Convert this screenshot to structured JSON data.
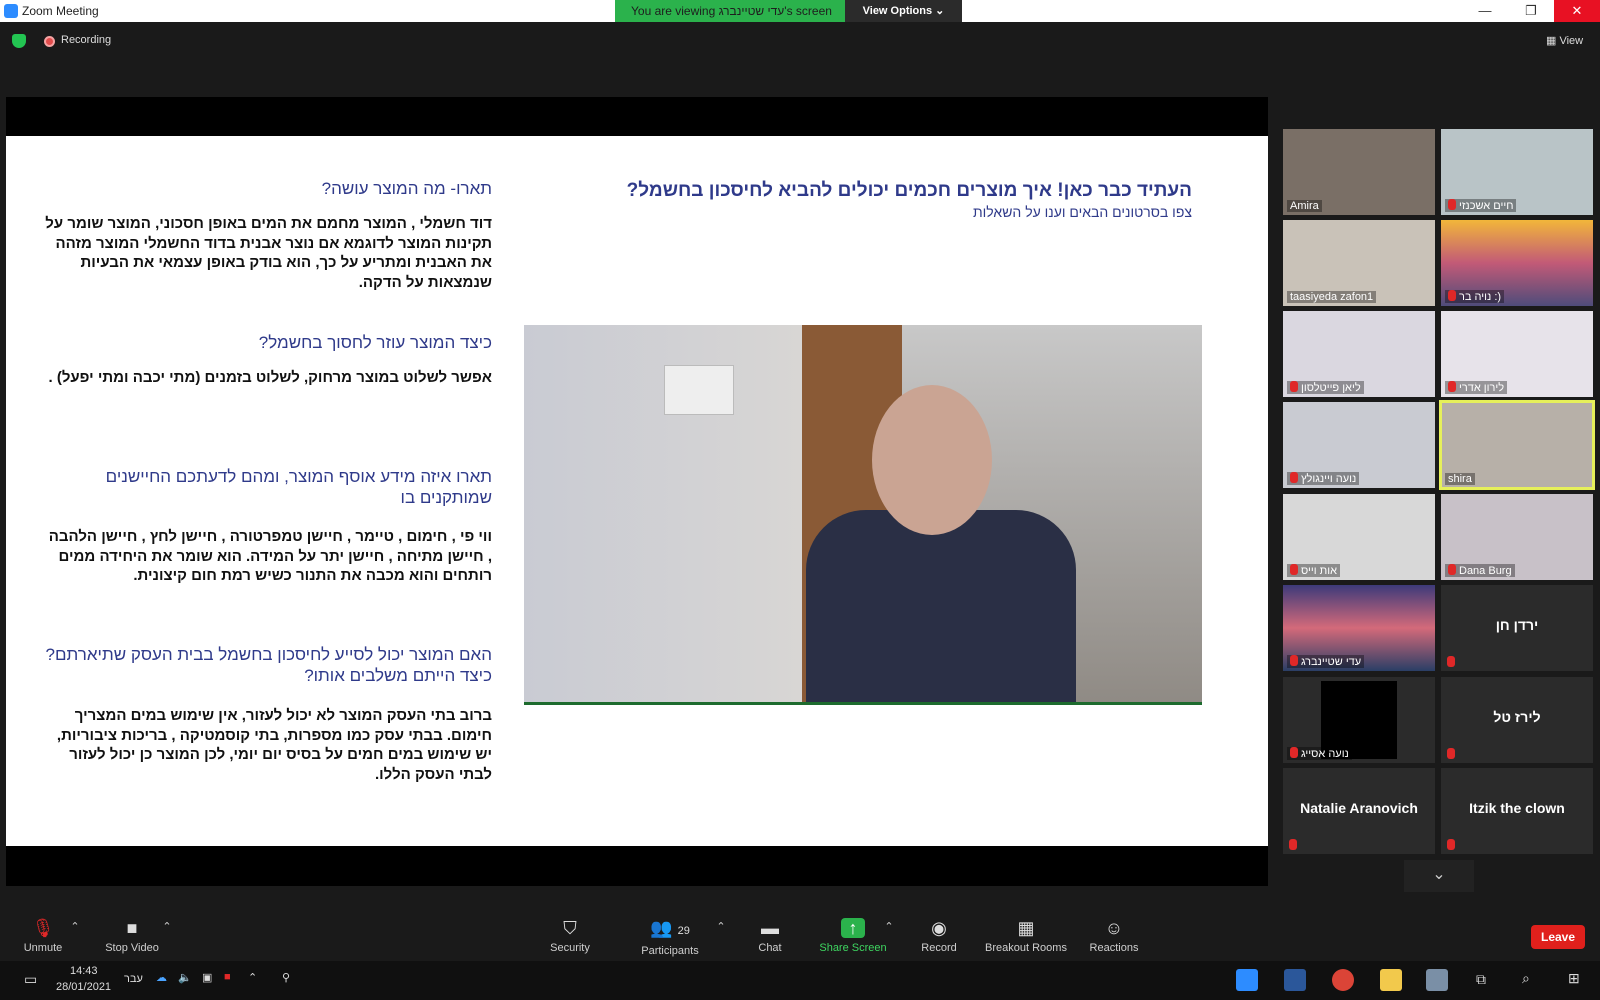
{
  "titlebar": {
    "app_title": "Zoom Meeting",
    "viewing_banner": "You are viewing עדי שטיינברג's screen",
    "view_options": "View Options ⌄",
    "min": "—",
    "max": "❐",
    "close": "✕"
  },
  "status": {
    "recording": "Recording",
    "view": "View"
  },
  "slide": {
    "title": "העתיד כבר כאן! איך מוצרים חכמים יכולים להביא לחיסכון בחשמל?",
    "subtitle": "צפו בסרטונים הבאים וענו על השאלות",
    "sections": [
      {
        "q": "תארו- מה המוצר עושה?",
        "a": "דוד חשמלי , המוצר מחמם את המים באופן חסכוני, המוצר שומר על תקינות המוצר לדוגמא אם נוצר אבנית בדוד החשמלי המוצר מזהה את האבנית ומתריע על כך, הוא בודק באופן עצמאי את הבעיות שנמצאות על הדקה."
      },
      {
        "q": "כיצד המוצר עוזר לחסוך בחשמל?",
        "a": "אפשר לשלוט במוצר מרחוק, לשלוט בזמנים (מתי יכבה ומתי יפעל) ."
      },
      {
        "q": "תארו איזה מידע אוסף המוצר, ומהם לדעתכם החיישנים שמותקנים בו",
        "a": "ווי פי , חימום , טיימר , חיישן טמפרטורה , חיישן לחץ , חיישן הלהבה , חיישן מתיחה , חיישן יתר על המידה. הוא שומר את היחידה ממים רותחים והוא מכבה את התנור כשיש רמת חום קיצונית."
      },
      {
        "q": "האם המוצר יכול לסייע לחיסכון בחשמל בבית העסק שתיארתם? כיצד הייתם משלבים אותו?",
        "a": "ברוב בתי העסק המוצר לא יכול לעזור, אין שימוש במים המצריך חימום. בבתי עסק כמו מספרות, בתי קוסמטיקה , בריכות ציבוריות, יש שימוש במים חמים על בסיס יום יומי, לכן המוצר כן יכול לעזור לבתי העסק הללו."
      }
    ]
  },
  "participants": [
    {
      "name": "Amira",
      "muted": false
    },
    {
      "name": "חיים אשכנזי",
      "muted": true
    },
    {
      "name": "taasiyeda zafon1",
      "muted": false
    },
    {
      "name": "נויה בר :)",
      "muted": true
    },
    {
      "name": "ליאן פייטלסון",
      "muted": true
    },
    {
      "name": "לירון אדרי",
      "muted": true
    },
    {
      "name": "נועה ויינגולץ",
      "muted": true
    },
    {
      "name": "shira",
      "muted": false
    },
    {
      "name": "אות וייס",
      "muted": true
    },
    {
      "name": "Dana Burg",
      "muted": true
    },
    {
      "name": "עדי שטיינברג",
      "muted": true
    },
    {
      "name": "ירדן חן",
      "muted": true
    },
    {
      "name": "נועה אסייג",
      "muted": true
    },
    {
      "name": "לירז טל",
      "muted": true
    },
    {
      "name": "Natalie Aranovich",
      "muted": true
    },
    {
      "name": "Itzik the clown",
      "muted": true
    }
  ],
  "toolbar": {
    "unmute": "Unmute",
    "stop_video": "Stop Video",
    "security": "Security",
    "participants": "Participants",
    "participants_count": "29",
    "chat": "Chat",
    "share_screen": "Share Screen",
    "record": "Record",
    "breakout": "Breakout Rooms",
    "reactions": "Reactions",
    "leave": "Leave"
  },
  "taskbar": {
    "time": "14:43",
    "date": "28/01/2021",
    "lang": "עבר"
  },
  "colors": {
    "share_green": "#2bb24c",
    "leave_red": "#e0201c",
    "active_speaker": "#e6f05a",
    "slide_heading": "#2f3a8a"
  }
}
